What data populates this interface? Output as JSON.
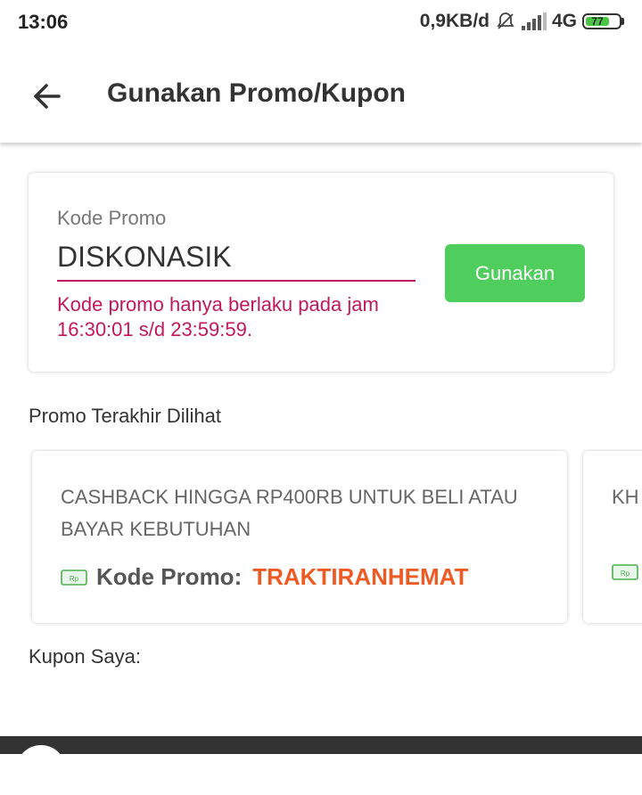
{
  "status_bar": {
    "time": "13:06",
    "network_speed": "0,9KB/d",
    "network_type": "4G",
    "battery": "77",
    "icons": [
      "bell-off-icon",
      "signal-icon",
      "battery-icon"
    ]
  },
  "app_bar": {
    "title": "Gunakan Promo/Kupon",
    "back_icon": "arrow-left-icon"
  },
  "promo_form": {
    "label": "Kode Promo",
    "value": "DISKONASIK",
    "error": "Kode promo hanya berlaku pada jam 16:30:01 s/d 23:59:59.",
    "button_label": "Gunakan",
    "colors": {
      "error": "#c2185b",
      "button": "#4fce5d"
    }
  },
  "recent_promos": {
    "title": "Promo Terakhir Dilihat",
    "items": [
      {
        "description": "CASHBACK HINGGA RP400RB UNTUK BELI ATAU BAYAR KEBUTUHAN",
        "code_label": "Kode Promo:",
        "code": "TRAKTIRANHEMAT",
        "icon": "money-icon"
      },
      {
        "description": "KH CAS",
        "code_label": "",
        "code": "",
        "icon": "money-icon"
      }
    ]
  },
  "coupons": {
    "title": "Kupon Saya:"
  },
  "colors": {
    "accent_code": "#ee5a24"
  }
}
